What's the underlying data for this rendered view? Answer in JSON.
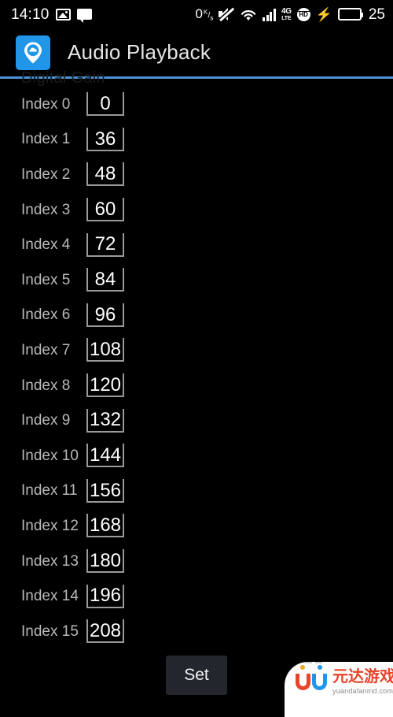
{
  "statusbar": {
    "time": "14:10",
    "icons_left": [
      "screenshot-icon",
      "message-icon"
    ],
    "net_speed": "0",
    "net_speed_unit_top": "K",
    "net_speed_unit_bottom": "s",
    "icons_right": [
      "mute-icon",
      "wifi-icon",
      "signal-icon",
      "4g-lte-icon",
      "hd-icon",
      "charging-bolt-icon",
      "battery-icon"
    ],
    "network_type_top": "4G",
    "network_type_bottom": "LTE",
    "hd_label": "HD",
    "bolt": "⚡",
    "battery_percent": "25"
  },
  "appbar": {
    "icon": "cloud-pin-icon",
    "title": "Audio Playback"
  },
  "section": {
    "scrolled_label": "Digital Gain"
  },
  "list": {
    "rows": [
      {
        "label": "Index 0",
        "value": "0"
      },
      {
        "label": "Index 1",
        "value": "36"
      },
      {
        "label": "Index 2",
        "value": "48"
      },
      {
        "label": "Index 3",
        "value": "60"
      },
      {
        "label": "Index 4",
        "value": "72"
      },
      {
        "label": "Index 5",
        "value": "84"
      },
      {
        "label": "Index 6",
        "value": "96"
      },
      {
        "label": "Index 7",
        "value": "108"
      },
      {
        "label": "Index 8",
        "value": "120"
      },
      {
        "label": "Index 9",
        "value": "132"
      },
      {
        "label": "Index 10",
        "value": "144"
      },
      {
        "label": "Index 11",
        "value": "156"
      },
      {
        "label": "Index 12",
        "value": "168"
      },
      {
        "label": "Index 13",
        "value": "180"
      },
      {
        "label": "Index 14",
        "value": "196"
      },
      {
        "label": "Index 15",
        "value": "208"
      }
    ]
  },
  "footer": {
    "set_label": "Set"
  },
  "watermark": {
    "brand_cn": "元达游戏",
    "url": "yuandafanmd.com"
  },
  "colors": {
    "background": "#000000",
    "accent_divider": "#4b92d6",
    "app_icon": "#2196e8",
    "battery_fill": "#3ddc3d",
    "button": "#23272d",
    "field_underline": "#9a9a9a",
    "label_text": "#b9b9b9"
  }
}
